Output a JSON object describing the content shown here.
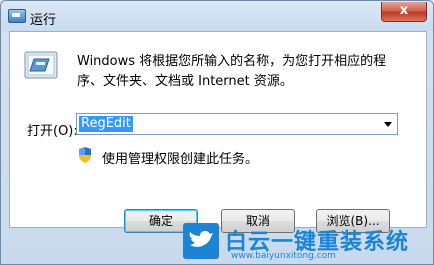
{
  "window": {
    "title": "运行",
    "close_label": "x"
  },
  "description": "Windows 将根据您所输入的名称，为您打开相应的程序、文件夹、文档或 Internet 资源。",
  "open": {
    "label": "打开(O):",
    "value": "RegEdit"
  },
  "admin_note": "使用管理权限创建此任务。",
  "buttons": {
    "ok": "确定",
    "cancel": "取消",
    "browse": "浏览(B)..."
  },
  "watermark": {
    "title": "白云一键重装系统",
    "url": "www.baiyunxitong.com"
  },
  "colors": {
    "selection": "#3399ff",
    "watermark": "#1b84d4",
    "close": "#c03b25"
  }
}
